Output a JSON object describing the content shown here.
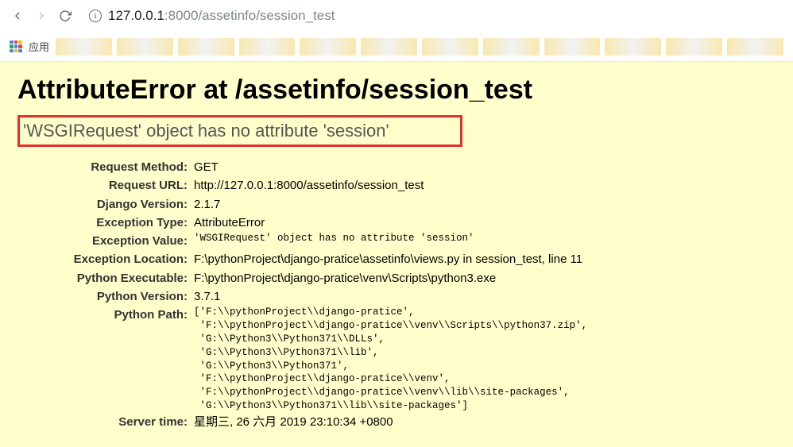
{
  "browser": {
    "url_host": "127.0.0.1",
    "url_port_path": ":8000/assetinfo/session_test",
    "apps_label": "应用"
  },
  "error": {
    "title": "AttributeError at /assetinfo/session_test",
    "subtitle": "'WSGIRequest' object has no attribute 'session'"
  },
  "details": {
    "request_method_label": "Request Method:",
    "request_method": "GET",
    "request_url_label": "Request URL:",
    "request_url": "http://127.0.0.1:8000/assetinfo/session_test",
    "django_version_label": "Django Version:",
    "django_version": "2.1.7",
    "exception_type_label": "Exception Type:",
    "exception_type": "AttributeError",
    "exception_value_label": "Exception Value:",
    "exception_value": "'WSGIRequest' object has no attribute 'session'",
    "exception_location_label": "Exception Location:",
    "exception_location": "F:\\pythonProject\\django-pratice\\assetinfo\\views.py in session_test, line 11",
    "python_executable_label": "Python Executable:",
    "python_executable": "F:\\pythonProject\\django-pratice\\venv\\Scripts\\python3.exe",
    "python_version_label": "Python Version:",
    "python_version": "3.7.1",
    "python_path_label": "Python Path:",
    "python_path": "['F:\\\\pythonProject\\\\django-pratice',\n 'F:\\\\pythonProject\\\\django-pratice\\\\venv\\\\Scripts\\\\python37.zip',\n 'G:\\\\Python3\\\\Python371\\\\DLLs',\n 'G:\\\\Python3\\\\Python371\\\\lib',\n 'G:\\\\Python3\\\\Python371',\n 'F:\\\\pythonProject\\\\django-pratice\\\\venv',\n 'F:\\\\pythonProject\\\\django-pratice\\\\venv\\\\lib\\\\site-packages',\n 'G:\\\\Python3\\\\Python371\\\\lib\\\\site-packages']",
    "server_time_label": "Server time:",
    "server_time": "星期三, 26 六月 2019 23:10:34 +0800"
  }
}
